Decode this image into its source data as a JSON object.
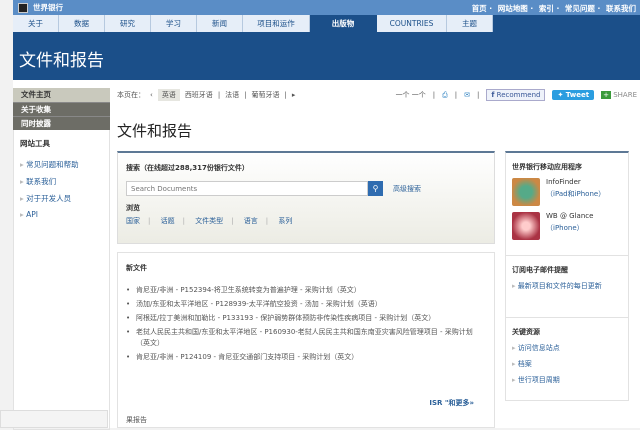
{
  "brand": "世界银行",
  "top_links": [
    "首页",
    "网站地图",
    "索引",
    "常见问题",
    "联系我们"
  ],
  "nav": [
    "关于",
    "数据",
    "研究",
    "学习",
    "新闻",
    "项目和运作",
    "出版物",
    "COUNTRIES",
    "主题"
  ],
  "banner_title": "文件和报告",
  "sidebar": {
    "items": [
      "文件主页",
      "关于收集",
      "同时披露"
    ],
    "tools_title": "网站工具",
    "tools": [
      "常见问题和帮助",
      "联系我们",
      "对于开发人员",
      "API"
    ]
  },
  "crumb": {
    "label": "本页在：",
    "langs": [
      "英语",
      "西班牙语",
      "法语",
      "葡萄牙语"
    ],
    "share_text": "一个 一个",
    "recommend": "Recommend",
    "tweet": "Tweet",
    "share": "SHARE"
  },
  "page_title": "文件和报告",
  "search": {
    "title": "搜索（在线超过288,317份银行文件）",
    "placeholder": "Search Documents",
    "advanced": "高级搜索",
    "browse": "浏览",
    "browse_links": [
      "国家",
      "话题",
      "文件类型",
      "语言",
      "系列"
    ]
  },
  "new_docs": {
    "title": "新文件",
    "items": [
      "肯尼亚/非洲 - P152394-将卫生系统转变为普遍护理 - 采购计划（英文）",
      "汤加/东亚和太平洋地区 - P128939-太平洋航空投资 - 汤加 - 采购计划（英语）",
      "阿根廷/拉丁美洲和加勒比 - P133193 - 保护弱势群体预防非传染性疾病项目 - 采购计划（英文）",
      "老挝人民民主共和国/东亚和太平洋地区 - P160930-老挝人民民主共和国东南亚灾害风险管理项目 - 采购计划（英文）",
      "肯尼亚/非洲 - P124109 - 肯尼亚交通部门支持项目 - 采购计划（英文）"
    ],
    "more": "ISR \"和更多»",
    "results": "果报告"
  },
  "right": {
    "apps_title": "世界银行移动应用程序",
    "apps": [
      {
        "name": "InfoFinder",
        "sub": "（iPad和iPhone）"
      },
      {
        "name": "WB @ Glance",
        "sub": "（iPhone）"
      }
    ],
    "email_title": "订阅电子邮件提醒",
    "email_link": "最新项目和文件的每日更新",
    "key_title": "关键资源",
    "key_links": [
      "访问信息站点",
      "档案",
      "世行项目周期"
    ]
  }
}
